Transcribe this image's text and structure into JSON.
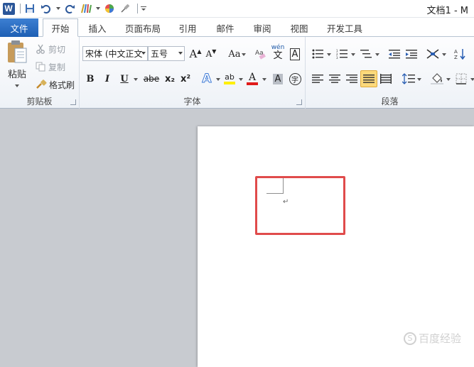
{
  "titlebar": {
    "title": "文档1 - M",
    "logo_letter": "W"
  },
  "tabs": [
    "文件",
    "开始",
    "插入",
    "页面布局",
    "引用",
    "邮件",
    "审阅",
    "视图",
    "开发工具"
  ],
  "clipboard": {
    "paste": "粘贴",
    "cut": "剪切",
    "copy": "复制",
    "format_painter": "格式刷",
    "label": "剪贴板"
  },
  "font": {
    "font_name": "宋体 (中文正文",
    "font_size": "五号",
    "grow": "A",
    "shrink": "A",
    "change_case": "Aa",
    "phonetic": "wén",
    "phonetic_char": "文",
    "char_border": "A",
    "bold": "B",
    "italic": "I",
    "underline": "U",
    "strike": "abe",
    "subscript": "x₂",
    "superscript": "x²",
    "text_effect": "A",
    "highlight": "ab",
    "font_color": "A",
    "char_shading": "A",
    "enclose": "字",
    "label": "字体"
  },
  "paragraph": {
    "label": "段落"
  },
  "colors": {
    "accent": "#2a5699",
    "file_tab": "#2b6ec5",
    "highlight_box": "#e04b4b",
    "highlight_yellow": "#ffef00",
    "font_red": "#e01b1b"
  },
  "document": {
    "paragraph_mark": "↵"
  },
  "watermark": {
    "text": "百度经验",
    "logo": "S"
  }
}
